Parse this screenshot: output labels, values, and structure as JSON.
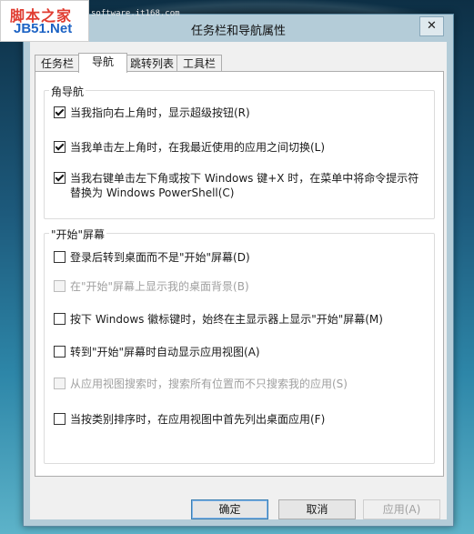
{
  "watermark": {
    "logo_top": "脚本之家",
    "logo_bottom": "JB51.Net",
    "url": "software.it168.com"
  },
  "window": {
    "title": "任务栏和导航属性",
    "close": "✕"
  },
  "tabs": [
    {
      "label": "任务栏",
      "active": false
    },
    {
      "label": "导航",
      "active": true
    },
    {
      "label": "跳转列表",
      "active": false
    },
    {
      "label": "工具栏",
      "active": false
    }
  ],
  "corner_nav": {
    "title": "角导航",
    "options": [
      {
        "label": "当我指向右上角时，显示超级按钮(R)",
        "checked": true,
        "enabled": true
      },
      {
        "label": "当我单击左上角时，在我最近使用的应用之间切换(L)",
        "checked": true,
        "enabled": true
      },
      {
        "label_line1": "当我右键单击左下角或按下 Windows 键+X 时，在菜单中将命令提示符",
        "label_line2": "替换为 Windows PowerShell(C)",
        "checked": true,
        "enabled": true
      }
    ]
  },
  "start_screen": {
    "title": "\"开始\"屏幕",
    "options": [
      {
        "label": "登录后转到桌面而不是\"开始\"屏幕(D)",
        "checked": false,
        "enabled": true
      },
      {
        "label": "在\"开始\"屏幕上显示我的桌面背景(B)",
        "checked": false,
        "enabled": false
      },
      {
        "label": "按下 Windows 徽标键时，始终在主显示器上显示\"开始\"屏幕(M)",
        "checked": false,
        "enabled": true
      },
      {
        "label": "转到\"开始\"屏幕时自动显示应用视图(A)",
        "checked": false,
        "enabled": true
      },
      {
        "label": "从应用视图搜索时，搜索所有位置而不只搜索我的应用(S)",
        "checked": false,
        "enabled": false
      },
      {
        "label": "当按类别排序时，在应用视图中首先列出桌面应用(F)",
        "checked": false,
        "enabled": true
      }
    ]
  },
  "buttons": {
    "ok": "确定",
    "cancel": "取消",
    "apply": "应用(A)"
  }
}
